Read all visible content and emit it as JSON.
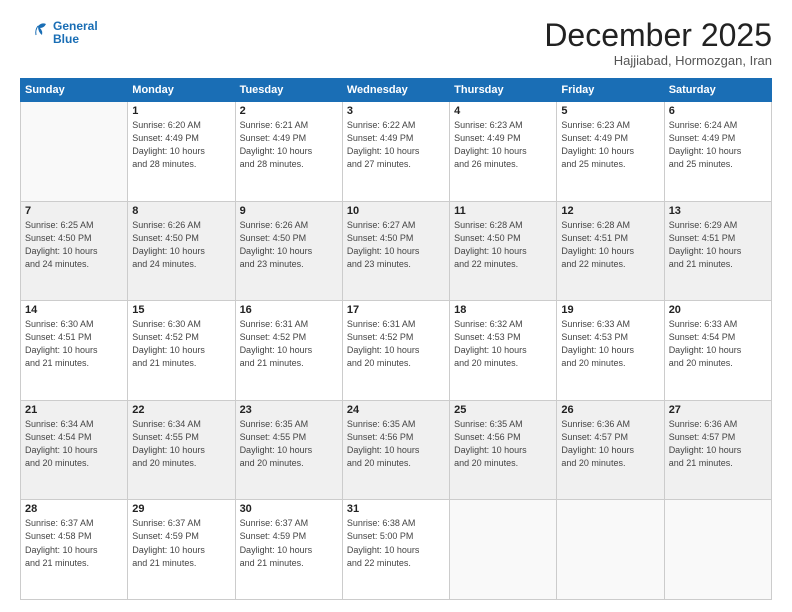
{
  "logo": {
    "line1": "General",
    "line2": "Blue"
  },
  "header": {
    "month": "December 2025",
    "location": "Hajjiabad, Hormozgan, Iran"
  },
  "weekdays": [
    "Sunday",
    "Monday",
    "Tuesday",
    "Wednesday",
    "Thursday",
    "Friday",
    "Saturday"
  ],
  "weeks": [
    [
      {
        "day": "",
        "info": ""
      },
      {
        "day": "1",
        "info": "Sunrise: 6:20 AM\nSunset: 4:49 PM\nDaylight: 10 hours\nand 28 minutes."
      },
      {
        "day": "2",
        "info": "Sunrise: 6:21 AM\nSunset: 4:49 PM\nDaylight: 10 hours\nand 28 minutes."
      },
      {
        "day": "3",
        "info": "Sunrise: 6:22 AM\nSunset: 4:49 PM\nDaylight: 10 hours\nand 27 minutes."
      },
      {
        "day": "4",
        "info": "Sunrise: 6:23 AM\nSunset: 4:49 PM\nDaylight: 10 hours\nand 26 minutes."
      },
      {
        "day": "5",
        "info": "Sunrise: 6:23 AM\nSunset: 4:49 PM\nDaylight: 10 hours\nand 25 minutes."
      },
      {
        "day": "6",
        "info": "Sunrise: 6:24 AM\nSunset: 4:49 PM\nDaylight: 10 hours\nand 25 minutes."
      }
    ],
    [
      {
        "day": "7",
        "info": "Sunrise: 6:25 AM\nSunset: 4:50 PM\nDaylight: 10 hours\nand 24 minutes."
      },
      {
        "day": "8",
        "info": "Sunrise: 6:26 AM\nSunset: 4:50 PM\nDaylight: 10 hours\nand 24 minutes."
      },
      {
        "day": "9",
        "info": "Sunrise: 6:26 AM\nSunset: 4:50 PM\nDaylight: 10 hours\nand 23 minutes."
      },
      {
        "day": "10",
        "info": "Sunrise: 6:27 AM\nSunset: 4:50 PM\nDaylight: 10 hours\nand 23 minutes."
      },
      {
        "day": "11",
        "info": "Sunrise: 6:28 AM\nSunset: 4:50 PM\nDaylight: 10 hours\nand 22 minutes."
      },
      {
        "day": "12",
        "info": "Sunrise: 6:28 AM\nSunset: 4:51 PM\nDaylight: 10 hours\nand 22 minutes."
      },
      {
        "day": "13",
        "info": "Sunrise: 6:29 AM\nSunset: 4:51 PM\nDaylight: 10 hours\nand 21 minutes."
      }
    ],
    [
      {
        "day": "14",
        "info": "Sunrise: 6:30 AM\nSunset: 4:51 PM\nDaylight: 10 hours\nand 21 minutes."
      },
      {
        "day": "15",
        "info": "Sunrise: 6:30 AM\nSunset: 4:52 PM\nDaylight: 10 hours\nand 21 minutes."
      },
      {
        "day": "16",
        "info": "Sunrise: 6:31 AM\nSunset: 4:52 PM\nDaylight: 10 hours\nand 21 minutes."
      },
      {
        "day": "17",
        "info": "Sunrise: 6:31 AM\nSunset: 4:52 PM\nDaylight: 10 hours\nand 20 minutes."
      },
      {
        "day": "18",
        "info": "Sunrise: 6:32 AM\nSunset: 4:53 PM\nDaylight: 10 hours\nand 20 minutes."
      },
      {
        "day": "19",
        "info": "Sunrise: 6:33 AM\nSunset: 4:53 PM\nDaylight: 10 hours\nand 20 minutes."
      },
      {
        "day": "20",
        "info": "Sunrise: 6:33 AM\nSunset: 4:54 PM\nDaylight: 10 hours\nand 20 minutes."
      }
    ],
    [
      {
        "day": "21",
        "info": "Sunrise: 6:34 AM\nSunset: 4:54 PM\nDaylight: 10 hours\nand 20 minutes."
      },
      {
        "day": "22",
        "info": "Sunrise: 6:34 AM\nSunset: 4:55 PM\nDaylight: 10 hours\nand 20 minutes."
      },
      {
        "day": "23",
        "info": "Sunrise: 6:35 AM\nSunset: 4:55 PM\nDaylight: 10 hours\nand 20 minutes."
      },
      {
        "day": "24",
        "info": "Sunrise: 6:35 AM\nSunset: 4:56 PM\nDaylight: 10 hours\nand 20 minutes."
      },
      {
        "day": "25",
        "info": "Sunrise: 6:35 AM\nSunset: 4:56 PM\nDaylight: 10 hours\nand 20 minutes."
      },
      {
        "day": "26",
        "info": "Sunrise: 6:36 AM\nSunset: 4:57 PM\nDaylight: 10 hours\nand 20 minutes."
      },
      {
        "day": "27",
        "info": "Sunrise: 6:36 AM\nSunset: 4:57 PM\nDaylight: 10 hours\nand 21 minutes."
      }
    ],
    [
      {
        "day": "28",
        "info": "Sunrise: 6:37 AM\nSunset: 4:58 PM\nDaylight: 10 hours\nand 21 minutes."
      },
      {
        "day": "29",
        "info": "Sunrise: 6:37 AM\nSunset: 4:59 PM\nDaylight: 10 hours\nand 21 minutes."
      },
      {
        "day": "30",
        "info": "Sunrise: 6:37 AM\nSunset: 4:59 PM\nDaylight: 10 hours\nand 21 minutes."
      },
      {
        "day": "31",
        "info": "Sunrise: 6:38 AM\nSunset: 5:00 PM\nDaylight: 10 hours\nand 22 minutes."
      },
      {
        "day": "",
        "info": ""
      },
      {
        "day": "",
        "info": ""
      },
      {
        "day": "",
        "info": ""
      }
    ]
  ]
}
